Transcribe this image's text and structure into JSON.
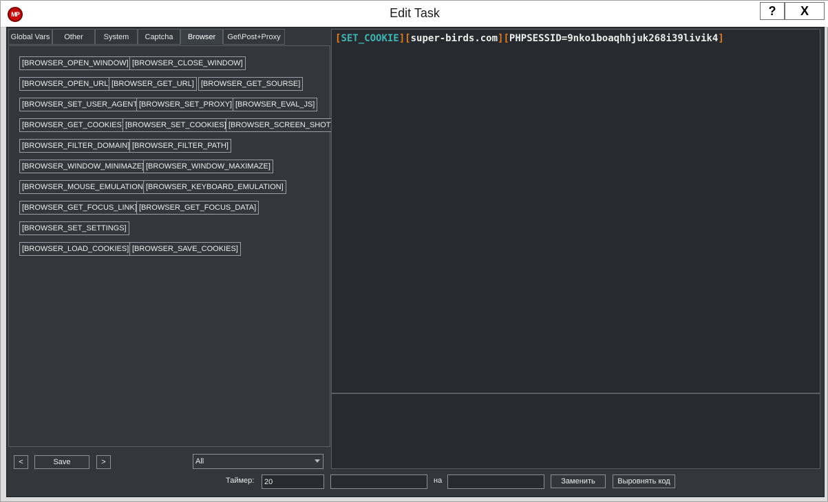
{
  "window": {
    "title": "Edit Task",
    "logo_text": "MP",
    "help_label": "?",
    "close_label": "X"
  },
  "tabs": [
    {
      "label": "Global Vars"
    },
    {
      "label": "Other"
    },
    {
      "label": "System"
    },
    {
      "label": "Captcha"
    },
    {
      "label": "Browser",
      "active": true
    },
    {
      "label": "Get\\Post+Proxy"
    }
  ],
  "commands": [
    [
      "[BROWSER_OPEN_WINDOW]",
      "[BROWSER_CLOSE_WINDOW]"
    ],
    [
      "[BROWSER_OPEN_URL]",
      "[BROWSER_GET_URL]",
      "[BROWSER_GET_SOURSE]"
    ],
    [
      "[BROWSER_SET_USER_AGENT]",
      "[BROWSER_SET_PROXY]",
      "[BROWSER_EVAL_JS]"
    ],
    [
      "[BROWSER_GET_COOKIES]",
      "[BROWSER_SET_COOKIES]",
      "[BROWSER_SCREEN_SHOT]"
    ],
    [
      "[BROWSER_FILTER_DOMAIN]",
      "[BROWSER_FILTER_PATH]"
    ],
    [
      "[BROWSER_WINDOW_MINIMAZE]",
      "[BROWSER_WINDOW_MAXIMAZE]"
    ],
    [
      "[BROWSER_MOUSE_EMULATION]",
      "[BROWSER_KEYBOARD_EMULATION]"
    ],
    [
      "[BROWSER_GET_FOCUS_LINK]",
      "[BROWSER_GET_FOCUS_DATA]"
    ],
    [
      "[BROWSER_SET_SETTINGS]"
    ],
    [
      "[BROWSER_LOAD_COOKIES]",
      "[BROWSER_SAVE_COOKIES]"
    ]
  ],
  "bottom_left": {
    "prev_label": "<",
    "save_label": "Save",
    "next_label": ">",
    "filter_value": "All"
  },
  "editor": {
    "open_bracket": "[",
    "close_bracket": "]",
    "command": "SET_COOKIE",
    "arg1": "super-birds.com",
    "arg2": "PHPSESSID=9nko1boaqhhjuk268i39livik4"
  },
  "bottom_bar": {
    "timer_label": "Таймер:",
    "timer_value": "20",
    "find_value": "",
    "to_label": "на",
    "replace_value": "",
    "replace_button": "Заменить",
    "align_button": "Выровнять код"
  }
}
